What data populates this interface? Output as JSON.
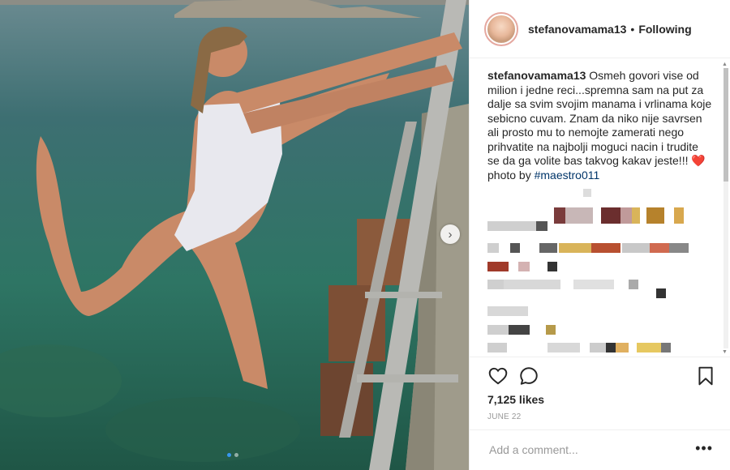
{
  "post": {
    "username": "stefanovamama13",
    "separator": "•",
    "follow_state": "Following",
    "caption_user": "stefanovamama13",
    "caption_text": "Osmeh govori vise od milion i jedne reci...spremna sam na put za dalje sa svim svojim manama i vrlinama koje sebicno cuvam. Znam da niko nije savrsen ali prosto mu to nemojte zamerati nego prihvatite na najbolji moguci nacin i trudite se da ga volite bas takvog kakav jeste!!!",
    "caption_heart": "❤️",
    "caption_photo_by": "photo by",
    "caption_tag": "#maestro011",
    "likes": "7,125 likes",
    "date": "JUNE 22",
    "comment_placeholder": "Add a comment...",
    "more_label": "•••"
  },
  "carousel": {
    "next_arrow": "›",
    "current_index": 1,
    "total": 2
  },
  "icons": {
    "heart": "heart-icon",
    "comment": "comment-icon",
    "bookmark": "bookmark-icon",
    "chevron": "chevron-right-icon"
  },
  "colors": {
    "link": "#003569",
    "heart": "#ed4956",
    "dot_active": "#3897f0"
  }
}
